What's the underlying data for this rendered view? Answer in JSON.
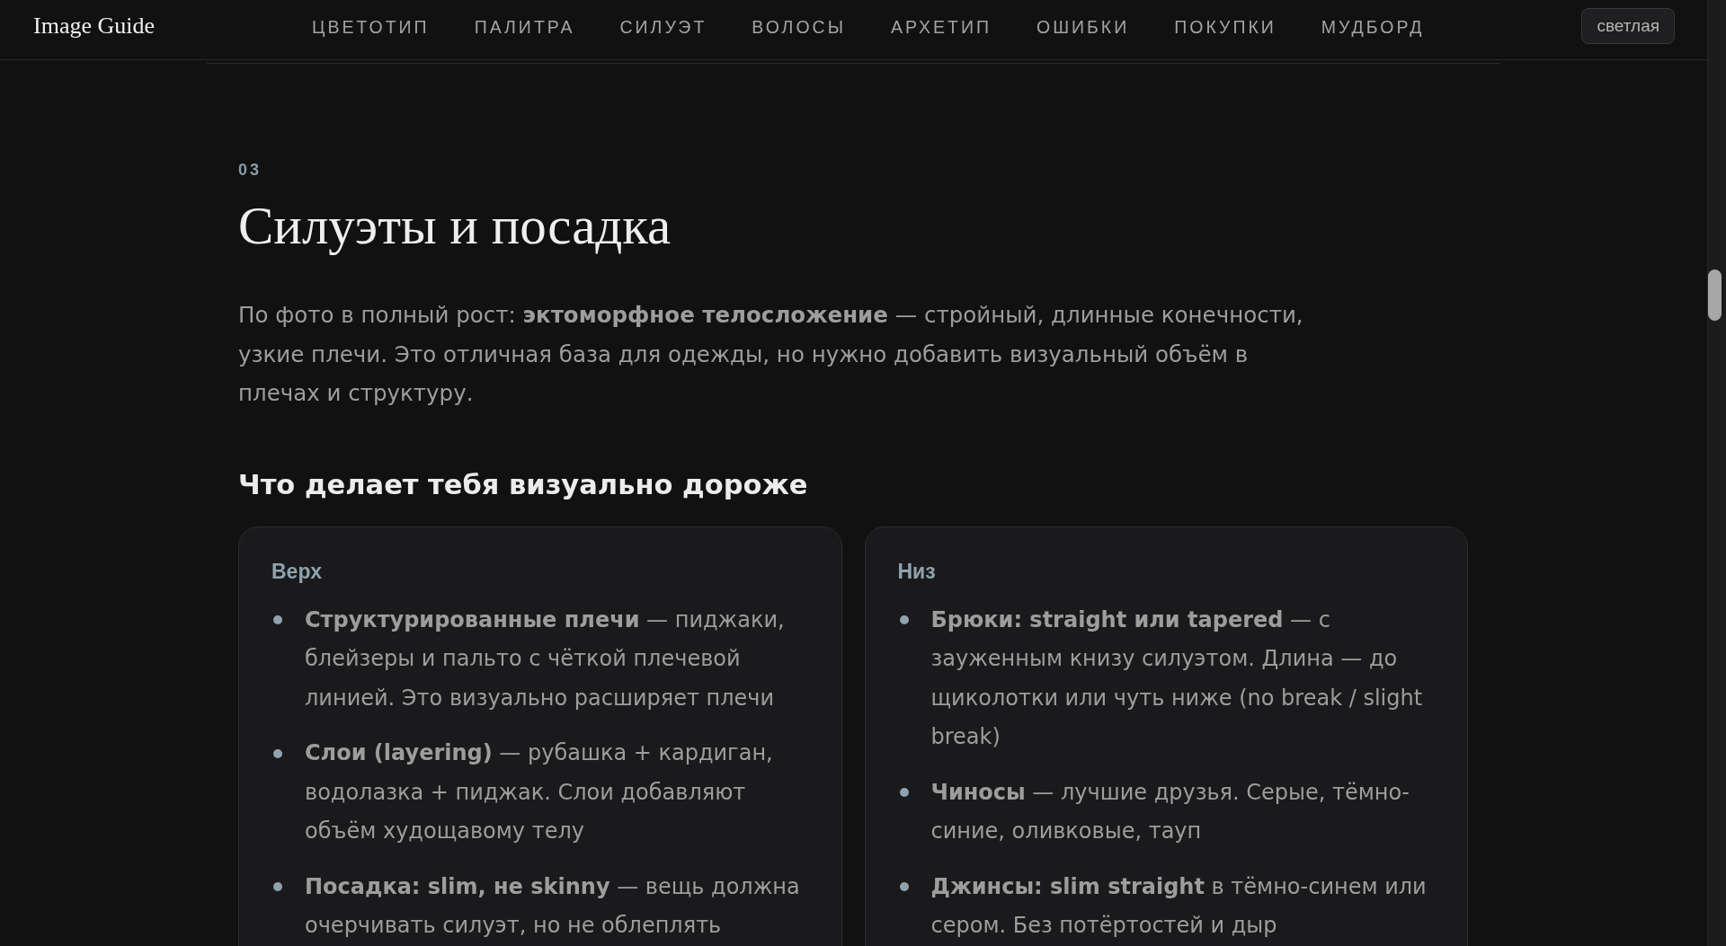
{
  "nav": {
    "logo": "Image Guide",
    "links": [
      "ЦВЕТОТИП",
      "ПАЛИТРА",
      "СИЛУЭТ",
      "ВОЛОСЫ",
      "АРХЕТИП",
      "ОШИБКИ",
      "ПОКУПКИ",
      "МУДБОРД"
    ],
    "theme_button": "светлая"
  },
  "section": {
    "number": "03",
    "title": "Силуэты и посадка",
    "intro": "По фото в полный рост: **эктоморфное телосложение** — стройный, длинные конечности, узкие плечи. Это отличная база для одежды, но нужно добавить визуальный объём в плечах и структуру.",
    "subheading": "Что делает тебя визуально дороже",
    "cards": [
      {
        "label": "Верх",
        "items": [
          "**Структурированные плечи** — пиджаки, блейзеры и пальто с чёткой плечевой линией. Это визуально расширяет плечи",
          "**Слои (layering)** — рубашка + кардиган, водолазка + пиджак. Слои добавляют объём худощавому телу",
          "**Посадка: slim, не skinny** — вещь должна очерчивать силуэт, но не облеплять"
        ]
      },
      {
        "label": "Низ",
        "items": [
          "**Брюки: straight или tapered** — с зауженным книзу силуэтом. Длина — до щиколотки или чуть ниже (no break / slight break)",
          "**Чиносы** — лучшие друзья. Серые, тёмно-синие, оливковые, тауп",
          "**Джинсы: slim straight** в тёмно-синем или сером. Без потёртостей и дыр"
        ]
      }
    ]
  }
}
